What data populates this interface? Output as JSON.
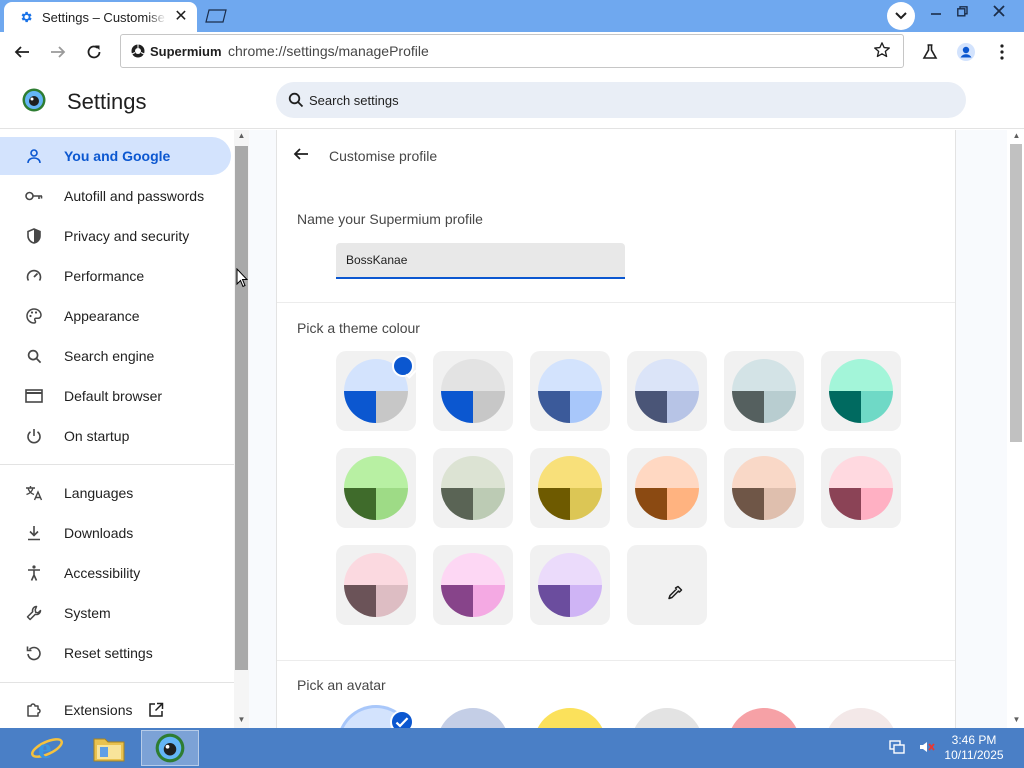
{
  "browser": {
    "tab_title": "Settings – Customise profile",
    "site_chip": "Supermium",
    "url": "chrome://settings/manageProfile"
  },
  "settings": {
    "title": "Settings",
    "search_placeholder": "Search settings",
    "nav": [
      {
        "label": "You and Google",
        "icon": "person-icon",
        "active": true
      },
      {
        "label": "Autofill and passwords",
        "icon": "key-icon"
      },
      {
        "label": "Privacy and security",
        "icon": "shield-icon"
      },
      {
        "label": "Performance",
        "icon": "speedometer-icon"
      },
      {
        "label": "Appearance",
        "icon": "palette-icon"
      },
      {
        "label": "Search engine",
        "icon": "search-icon"
      },
      {
        "label": "Default browser",
        "icon": "browser-window-icon"
      },
      {
        "label": "On startup",
        "icon": "power-icon"
      },
      {
        "label": "Languages",
        "icon": "translate-icon"
      },
      {
        "label": "Downloads",
        "icon": "download-icon"
      },
      {
        "label": "Accessibility",
        "icon": "accessibility-icon"
      },
      {
        "label": "System",
        "icon": "wrench-icon"
      },
      {
        "label": "Reset settings",
        "icon": "reset-icon"
      },
      {
        "label": "Extensions",
        "icon": "puzzle-icon"
      }
    ]
  },
  "profile": {
    "heading": "Customise profile",
    "name_label": "Name your Supermium profile",
    "name_value": "BossKanae",
    "theme_label": "Pick a theme colour",
    "avatar_label": "Pick an avatar",
    "themes": [
      {
        "top": "#d3e3fd",
        "left": "#0b57d0",
        "right": "#c7c7c7",
        "selected": true
      },
      {
        "top": "#e3e3e3",
        "left": "#0b57d0",
        "right": "#c7c7c7"
      },
      {
        "top": "#d3e3fd",
        "left": "#3b5a9a",
        "right": "#a8c7fa"
      },
      {
        "top": "#dbe4f8",
        "left": "#4a5577",
        "right": "#b7c4e6"
      },
      {
        "top": "#d3e3e6",
        "left": "#55605f",
        "right": "#b8cdd0"
      },
      {
        "top": "#a3f5d9",
        "left": "#006a60",
        "right": "#6fd9c6"
      },
      {
        "top": "#b8f0a3",
        "left": "#3f6b2b",
        "right": "#9edb86"
      },
      {
        "top": "#dce3d3",
        "left": "#5a6455",
        "right": "#bccbb4"
      },
      {
        "top": "#f8e07a",
        "left": "#6e5a00",
        "right": "#dcc655"
      },
      {
        "top": "#ffd8c2",
        "left": "#8b4a12",
        "right": "#ffb380"
      },
      {
        "top": "#f9d8c7",
        "left": "#6f5647",
        "right": "#dfbfae"
      },
      {
        "top": "#ffd9e0",
        "left": "#8b4356",
        "right": "#ffb0c3"
      },
      {
        "top": "#fbd9e0",
        "left": "#6b5358",
        "right": "#ddbdc3"
      },
      {
        "top": "#fdd7f4",
        "left": "#87448a",
        "right": "#f4a9e3"
      },
      {
        "top": "#ebdbfb",
        "left": "#6b4d9e",
        "right": "#cfb4f5"
      }
    ],
    "custom_theme_icon": "eyedropper-icon",
    "avatars": [
      {
        "color": "#d3e3fd",
        "selected": true
      },
      {
        "color": "#c4cee6"
      },
      {
        "color": "#fbe15b"
      },
      {
        "color": "#e3e3e3"
      },
      {
        "color": "#f6a1a6"
      },
      {
        "color": "#f3e8e8"
      }
    ]
  },
  "taskbar": {
    "apps": [
      "internet-explorer-icon",
      "file-explorer-icon",
      "supermium-icon"
    ],
    "time": "3:46 PM",
    "date": "10/11/2025"
  },
  "colors": {
    "accent": "#0b57d0",
    "active_nav_bg": "#d3e3fd",
    "titlebar": "#6fa8ef",
    "taskbar": "#4a7fc6"
  }
}
